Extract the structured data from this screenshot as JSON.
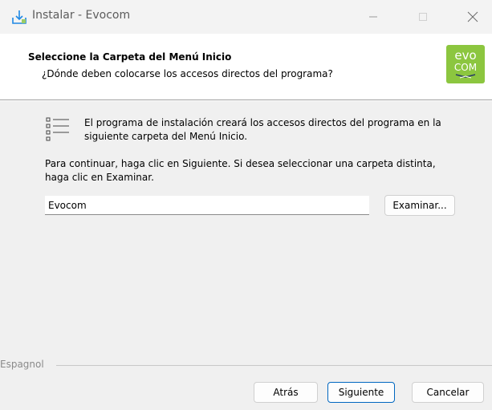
{
  "window": {
    "title": "Instalar - Evocom"
  },
  "header": {
    "title": "Seleccione la Carpeta del Menú Inicio",
    "subtitle": "¿Dónde deben colocarse los accesos directos del programa?",
    "logo_top": "evo",
    "logo_bottom": "COM"
  },
  "content": {
    "intro_line1": "El programa de instalación creará los accesos directos del programa en la",
    "intro_line2": "siguiente carpeta del Menú Inicio.",
    "continue_line1": "Para continuar, haga clic en Siguiente. Si desea seleccionar una carpeta distinta,",
    "continue_line2": "haga clic en Examinar.",
    "folder_value": "Evocom",
    "browse_label": "Examinar..."
  },
  "footer": {
    "language_label": "Espagnol",
    "back_label": "Atrás",
    "next_label": "Siguiente",
    "cancel_label": "Cancelar"
  },
  "colors": {
    "logo_green": "#8cc63f",
    "focus_blue": "#0067c0"
  }
}
